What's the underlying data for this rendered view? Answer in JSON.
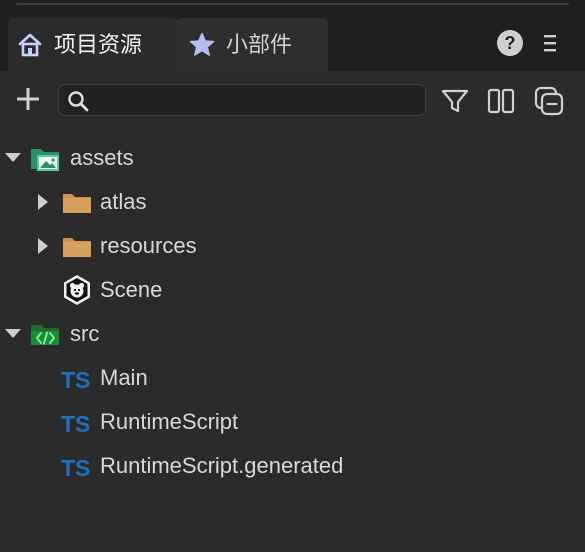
{
  "colors": {
    "background": "#2b2b2b",
    "header": "#1f1f1f",
    "folder": "#c8934f",
    "ts_blue": "#1f6fbe",
    "assets_green": "#2f8f6a",
    "src_green": "#1e8b3a",
    "icon_light": "#d0d0d0"
  },
  "tabs": [
    {
      "label": "项目资源",
      "icon": "home-icon",
      "active": true
    },
    {
      "label": "小部件",
      "icon": "star-icon",
      "active": false
    }
  ],
  "header": {
    "help": "?"
  },
  "search": {
    "placeholder": "",
    "value": ""
  },
  "tree": [
    {
      "label": "assets",
      "icon": "assets-folder-icon",
      "expanded": true
    },
    {
      "label": "atlas",
      "icon": "folder-icon",
      "expanded": false
    },
    {
      "label": "resources",
      "icon": "folder-icon",
      "expanded": false
    },
    {
      "label": "Scene",
      "icon": "scene-icon"
    },
    {
      "label": "src",
      "icon": "src-folder-icon",
      "expanded": true
    },
    {
      "label": "Main",
      "icon": "ts-icon"
    },
    {
      "label": "RuntimeScript",
      "icon": "ts-icon"
    },
    {
      "label": "RuntimeScript.generated",
      "icon": "ts-icon"
    }
  ]
}
